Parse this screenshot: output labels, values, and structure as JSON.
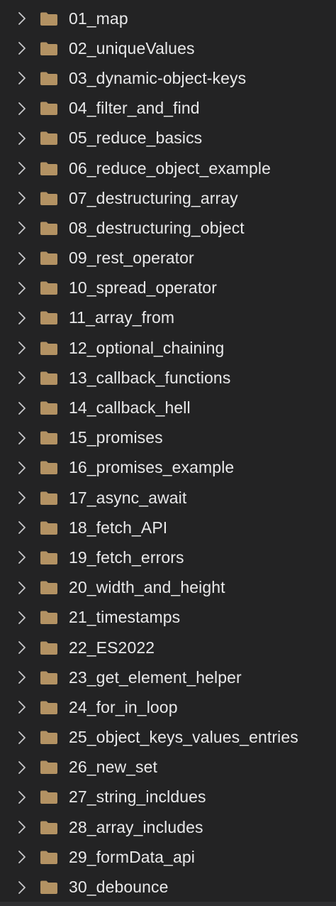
{
  "explorer": {
    "chevron_icon": "chevron-right-icon",
    "folder_icon": "folder-icon",
    "colors": {
      "background": "#232324",
      "text": "#e9e9ea",
      "chevron": "#c9c9cb",
      "folder": "#b39263"
    },
    "folders": [
      "01_map",
      "02_uniqueValues",
      "03_dynamic-object-keys",
      "04_filter_and_find",
      "05_reduce_basics",
      "06_reduce_object_example",
      "07_destructuring_array",
      "08_destructuring_object",
      "09_rest_operator",
      "10_spread_operator",
      "11_array_from",
      "12_optional_chaining",
      "13_callback_functions",
      "14_callback_hell",
      "15_promises",
      "16_promises_example",
      "17_async_await",
      "18_fetch_API",
      "19_fetch_errors",
      "20_width_and_height",
      "21_timestamps",
      "22_ES2022",
      "23_get_element_helper",
      "24_for_in_loop",
      "25_object_keys_values_entries",
      "26_new_set",
      "27_string_incldues",
      "28_array_includes",
      "29_formData_api",
      "30_debounce"
    ]
  }
}
